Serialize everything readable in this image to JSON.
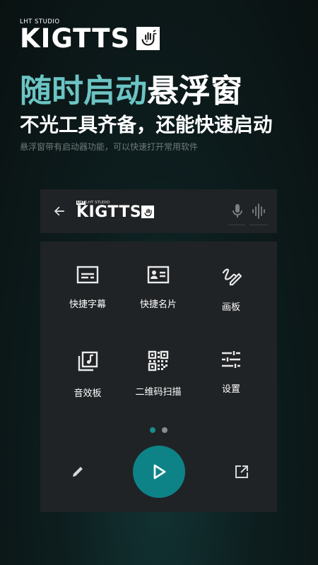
{
  "brand": {
    "studio_badge": "LHT",
    "studio_text": "LHT STUDIO",
    "name": "KIGTTS"
  },
  "headline": {
    "accent": "随时启动",
    "rest": "悬浮窗",
    "subtitle": "不光工具齐备，还能快速启动",
    "caption": "悬浮窗带有启动器功能，可以快速打开常用软件"
  },
  "appbar": {
    "brand_badge": "LHT",
    "brand_studio": "LHT STUDIO",
    "brand_name": "KIGTTS",
    "icons": [
      "back-arrow-icon",
      "microphone-icon",
      "sound-wave-icon"
    ]
  },
  "tools": [
    {
      "label": "快捷字幕",
      "icon": "subtitles-icon"
    },
    {
      "label": "快捷名片",
      "icon": "contact-card-icon"
    },
    {
      "label": "画板",
      "icon": "draw-icon"
    },
    {
      "label": "音效板",
      "icon": "music-library-icon"
    },
    {
      "label": "二维码扫描",
      "icon": "qr-code-icon"
    },
    {
      "label": "设置",
      "icon": "tune-settings-icon"
    }
  ],
  "pager": {
    "pages": 2,
    "current": 1
  },
  "controls": {
    "icons": [
      "pencil-icon",
      "play-icon",
      "open-external-icon"
    ]
  },
  "colors": {
    "accent": "#6cc4c4",
    "play_button": "#0d8388",
    "panel": "#202325",
    "dot_active": "#1a8b90",
    "dot_inactive": "#8a8e90"
  }
}
